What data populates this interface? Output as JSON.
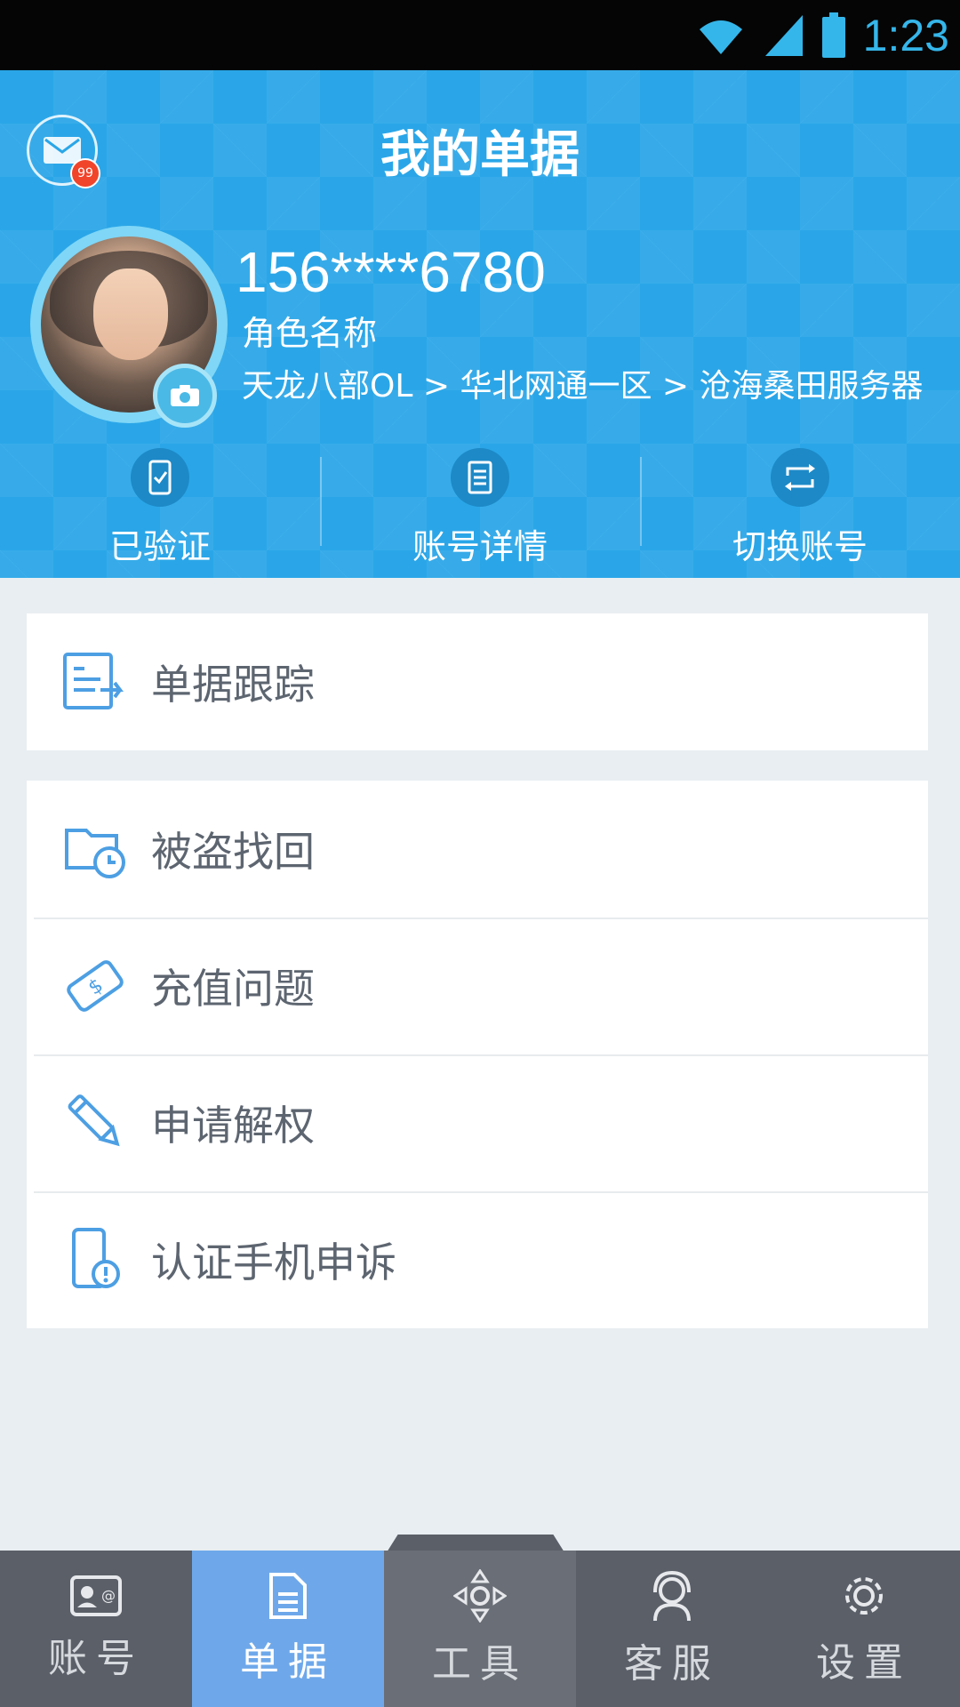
{
  "status_bar": {
    "time": "1:23"
  },
  "header": {
    "title": "我的单据",
    "mail_badge": "99",
    "phone": "156****6780",
    "role_name": "角色名称",
    "server_path": "天龙八部OL > 华北网通一区 > 沧海桑田服务器"
  },
  "quick_actions": [
    {
      "label": "已验证",
      "icon": "verified-phone-icon"
    },
    {
      "label": "账号详情",
      "icon": "document-icon"
    },
    {
      "label": "切换账号",
      "icon": "switch-icon"
    }
  ],
  "menu_primary": [
    {
      "label": "单据跟踪",
      "icon": "ticket-tracking-icon"
    }
  ],
  "menu_secondary": [
    {
      "label": "被盗找回",
      "icon": "folder-clock-icon"
    },
    {
      "label": "充值问题",
      "icon": "dollar-ticket-icon"
    },
    {
      "label": "申请解权",
      "icon": "pencil-icon"
    },
    {
      "label": "认证手机申诉",
      "icon": "phone-alert-icon"
    }
  ],
  "bottom_nav": [
    {
      "label": "账号",
      "icon": "account-card-icon"
    },
    {
      "label": "单据",
      "icon": "document-icon",
      "active": true
    },
    {
      "label": "工具",
      "icon": "tools-icon"
    },
    {
      "label": "客服",
      "icon": "headset-icon"
    },
    {
      "label": "设置",
      "icon": "gear-icon"
    }
  ],
  "colors": {
    "header_bg": "#2aa6e8",
    "active_tab": "#6ea8ea",
    "nav_bg": "#5a5f68",
    "icon_blue": "#4d9fe3",
    "badge_red": "#f0442b"
  }
}
